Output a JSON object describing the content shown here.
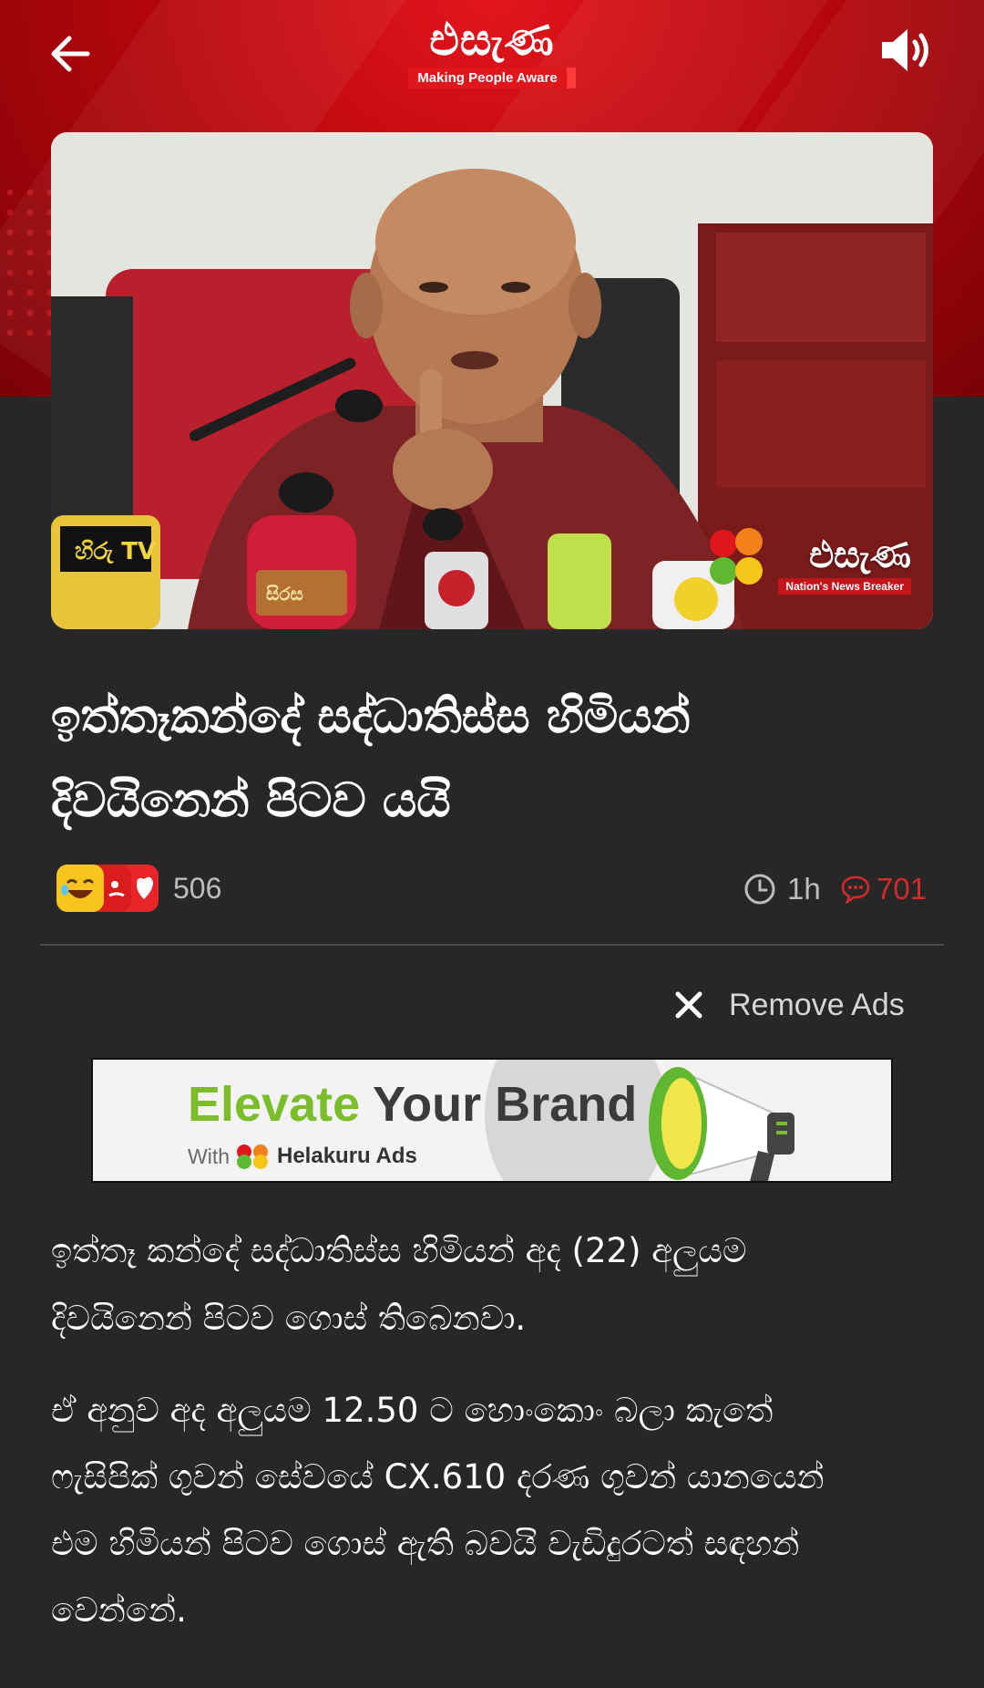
{
  "header": {
    "logo_text": "එසැණ",
    "logo_tagline": "Making People Aware",
    "back_icon": "arrow-left-icon",
    "sound_icon": "speaker-icon"
  },
  "hero": {
    "watermark_text": "එසැණ",
    "watermark_tagline": "Nation's News Breaker",
    "mic_labels": [
      "හිරු TV",
      "සිරස"
    ]
  },
  "article": {
    "headline_line1": "ඉත්තෑකන්දේ සද්ධාතිස්ස හිමියන්",
    "headline_line2": "දිවයිනෙන් පිටව යයි",
    "reaction_count": "506",
    "time": "1h",
    "comment_count": "701",
    "paragraph1_line1": "ඉත්තෑ කන්දේ සද්ධාතිස්ස හිමියන් අද (22) අලුයම",
    "paragraph1_line2": "දිවයිනෙන් පිටව ගොස් තිබෙනවා.",
    "paragraph2_line1": "ඒ අනුව අද අලුයම 12.50 ට හොංකොං බලා කැතේ",
    "paragraph2_line2": "ෆැසිපික් ගුවන් සේවයේ CX.610 දරණ ගුවන් යානයෙන්",
    "paragraph2_line3": "එම හිමියන් පිටව ගොස් ඇති බවයි වැඩිදුරටත් සඳහන්",
    "paragraph2_line4": "වෙන්නේ."
  },
  "ads": {
    "remove_label": "Remove Ads",
    "banner_word1": "Elevate",
    "banner_word2": "Your Brand",
    "banner_with": "With",
    "banner_brand": "Helakuru Ads"
  },
  "colors": {
    "background": "#272727",
    "brand_red": "#d42a2a",
    "ad_green": "#7cbd2c"
  }
}
